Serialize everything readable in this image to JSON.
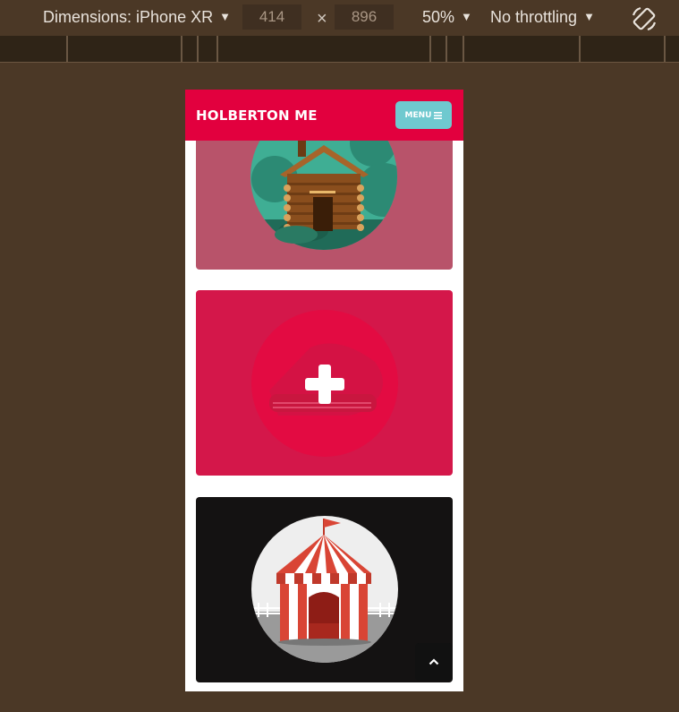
{
  "devtools": {
    "dimensions_label": "Dimensions: iPhone XR",
    "width": "414",
    "times": "×",
    "height": "896",
    "zoom": "50%",
    "throttling": "No throttling",
    "rotate_icon": "rotate-icon"
  },
  "site": {
    "brand": "HOLBERTON ME",
    "menu_label": "MENU",
    "menu_icon": "hamburger-icon",
    "back_to_top_icon": "chevron-up-icon"
  },
  "cards": [
    {
      "name": "cabin",
      "background": "#b8536a"
    },
    {
      "name": "add",
      "background": "#d4174a"
    },
    {
      "name": "circus",
      "background": "#141212"
    }
  ],
  "colors": {
    "header": "#e2003e",
    "menu_button": "#6fc9cf",
    "devtools_bg": "#4b3826"
  }
}
